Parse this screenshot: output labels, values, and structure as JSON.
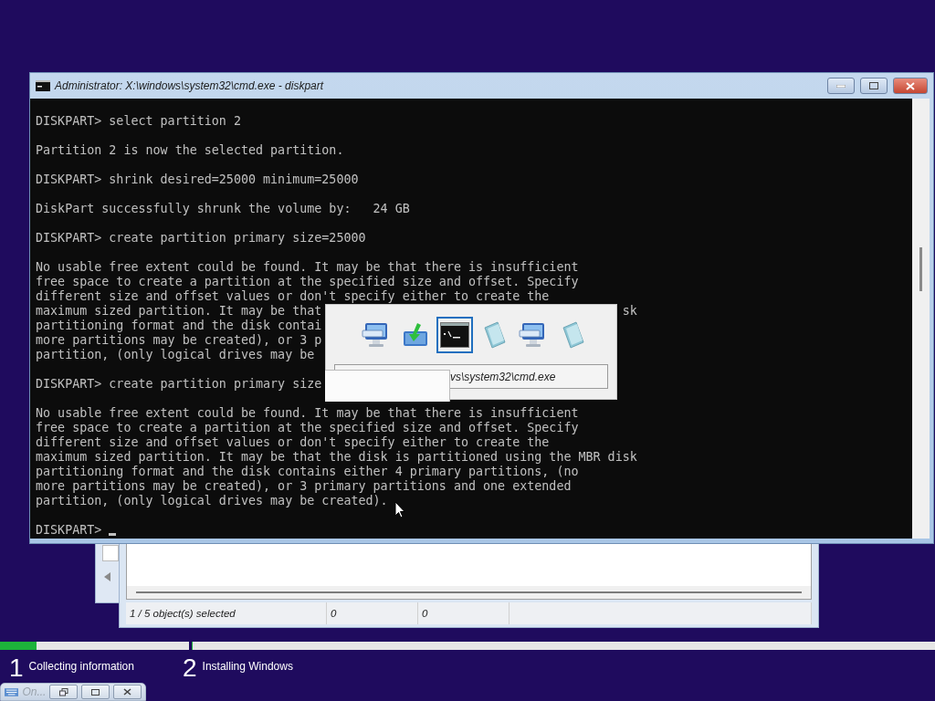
{
  "console_window": {
    "title": "Administrator: X:\\windows\\system32\\cmd.exe - diskpart",
    "blocks": [
      {
        "lines": [
          {
            "text": "DISKPART> select partition 2"
          }
        ]
      },
      {
        "lines": [
          {
            "text": "Partition 2 is now the selected partition."
          }
        ]
      },
      {
        "lines": [
          {
            "text": "DISKPART> shrink desired=25000 minimum=25000"
          }
        ]
      },
      {
        "lines": [
          {
            "text": "DiskPart successfully shrunk the volume by:   24 GB"
          }
        ]
      },
      {
        "lines": [
          {
            "text": "DISKPART> create partition primary size=25000"
          }
        ]
      },
      {
        "lines": [
          {
            "text": "No usable free extent could be found. It may be that there is insufficient"
          },
          {
            "text": "free space to create a partition at the specified size and offset. Specify"
          },
          {
            "text": "different size and offset values or don't specify either to create the"
          },
          {
            "text": "maximum sized partition. It may be that",
            "tail": "sk"
          },
          {
            "text": "partitioning format and the disk contai"
          },
          {
            "text": "more partitions may be created), or 3 p"
          },
          {
            "text": "partition, (only logical drives may be"
          }
        ]
      },
      {
        "lines": [
          {
            "text": "DISKPART> create partition primary size"
          }
        ]
      },
      {
        "lines": [
          {
            "text": "No usable free extent could be found. It may be that there is insufficient"
          },
          {
            "text": "free space to create a partition at the specified size and offset. Specify"
          },
          {
            "text": "different size and offset values or don't specify either to create the"
          },
          {
            "text": "maximum sized partition. It may be that the disk is partitioned using the MBR disk"
          },
          {
            "text": "partitioning format and the disk contains either 4 primary partitions, (no"
          },
          {
            "text": "more partitions may be created), or 3 primary partitions and one extended"
          },
          {
            "text": "partition, (only logical drives may be created)."
          }
        ]
      },
      {
        "lines": [
          {
            "text": "DISKPART>",
            "cursor": true
          }
        ]
      }
    ]
  },
  "task_switcher": {
    "items": [
      {
        "kind": "remote",
        "selected": false
      },
      {
        "kind": "setup",
        "selected": false
      },
      {
        "kind": "console",
        "selected": true
      },
      {
        "kind": "notepad",
        "selected": false
      },
      {
        "kind": "remote",
        "selected": false
      },
      {
        "kind": "notepad",
        "selected": false
      }
    ],
    "caption": "vs\\system32\\cmd.exe"
  },
  "background_window": {
    "status_bar": [
      "1 / 5 object(s) selected",
      "0",
      "0"
    ]
  },
  "setup_progress": {
    "steps": [
      {
        "number": "1",
        "label": "Collecting information",
        "level": 0.19
      },
      {
        "number": "2",
        "label": "Installing Windows",
        "level": 0
      }
    ]
  },
  "keyboard_bar": {
    "label": "On..."
  }
}
